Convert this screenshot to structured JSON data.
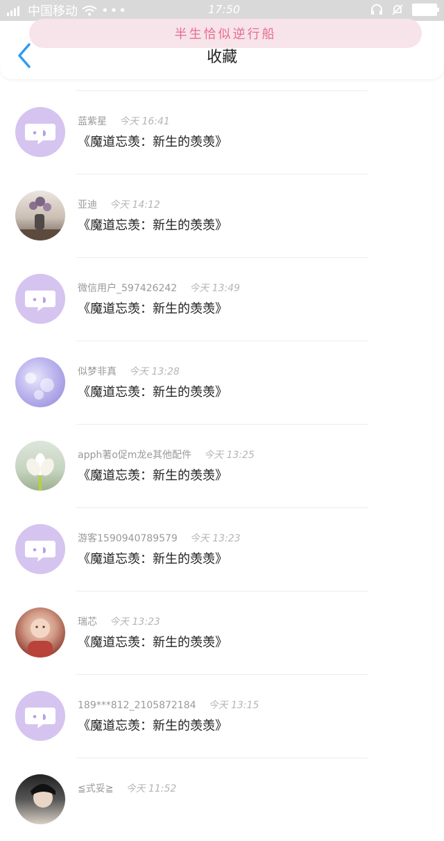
{
  "status_bar": {
    "carrier": "中国移动",
    "time": "17:50"
  },
  "banner": {
    "text": "半生恰似逆行船"
  },
  "header": {
    "title": "收藏"
  },
  "favorites": [
    {
      "name": "蓝紫星",
      "time": "今天 16:41",
      "message": "《魔道忘羡：新生的羡羡》",
      "avatar": "chat-bubble"
    },
    {
      "name": "亚迪",
      "time": "今天 14:12",
      "message": "《魔道忘羡：新生的羡羡》",
      "avatar": "photo-vase"
    },
    {
      "name": "微信用户_597426242",
      "time": "今天 13:49",
      "message": "《魔道忘羡：新生的羡羡》",
      "avatar": "chat-bubble"
    },
    {
      "name": "似梦非真",
      "time": "今天 13:28",
      "message": "《魔道忘羡：新生的羡羡》",
      "avatar": "photo-clouds"
    },
    {
      "name": "apph著o促m龙e其他配件",
      "time": "今天 13:25",
      "message": "《魔道忘羡：新生的羡羡》",
      "avatar": "photo-lotus"
    },
    {
      "name": "游客1590940789579",
      "time": "今天 13:23",
      "message": "《魔道忘羡：新生的羡羡》",
      "avatar": "chat-bubble"
    },
    {
      "name": "瑞芯",
      "time": "今天 13:23",
      "message": "《魔道忘羡：新生的羡羡》",
      "avatar": "photo-baby"
    },
    {
      "name": "189***812_2105872184",
      "time": "今天 13:15",
      "message": "《魔道忘羡：新生的羡羡》",
      "avatar": "chat-bubble"
    },
    {
      "name": "≦式妥≧",
      "time": "今天 11:52",
      "message": "",
      "avatar": "photo-person"
    }
  ],
  "colors": {
    "accent": "#2f9bf2",
    "avatar_bubble_bg": "#d5c4f0",
    "banner_bg": "#f7e3ea",
    "banner_text": "#e66e8f"
  }
}
